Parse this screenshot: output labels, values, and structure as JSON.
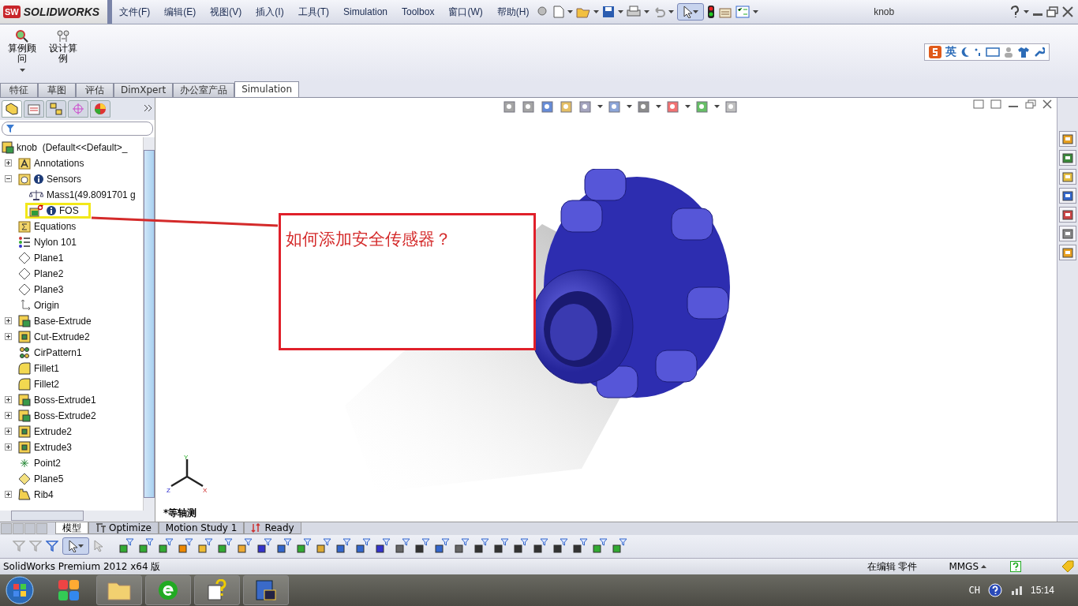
{
  "app": {
    "logo_badge": "SW",
    "logo": "SOLIDWORKS",
    "title": "knob"
  },
  "menu": [
    {
      "label": "文件(F)"
    },
    {
      "label": "编辑(E)"
    },
    {
      "label": "视图(V)"
    },
    {
      "label": "插入(I)"
    },
    {
      "label": "工具(T)"
    },
    {
      "label": "Simulation"
    },
    {
      "label": "Toolbox"
    },
    {
      "label": "窗口(W)"
    },
    {
      "label": "帮助(H)"
    }
  ],
  "commands": [
    {
      "label": "算例顾问",
      "dropdown": true
    },
    {
      "label": "设计算例",
      "dropdown": false
    }
  ],
  "ime": {
    "mode": "英"
  },
  "tabs": [
    {
      "label": "特征",
      "selected": false
    },
    {
      "label": "草图",
      "selected": false
    },
    {
      "label": "评估",
      "selected": false
    },
    {
      "label": "DimXpert",
      "selected": false
    },
    {
      "label": "办公室产品",
      "selected": false
    },
    {
      "label": "Simulation",
      "selected": true
    }
  ],
  "panel_tabs": [
    {
      "kind": "tree",
      "selected": true
    },
    {
      "kind": "property",
      "selected": false
    },
    {
      "kind": "config",
      "selected": false
    },
    {
      "kind": "dim",
      "selected": false
    },
    {
      "kind": "display",
      "selected": false
    }
  ],
  "tree": {
    "root": "knob  (Default<<Default>_",
    "items": [
      {
        "label": "Annotations",
        "kind": "annotations",
        "expanded": false
      },
      {
        "label": "Sensors",
        "kind": "sensors",
        "expanded": true,
        "info": true,
        "children": [
          {
            "label": "Mass1(49.8091701 g",
            "kind": "mass"
          },
          {
            "label": "FOS",
            "kind": "fos",
            "info": true,
            "highlighted": true
          }
        ]
      },
      {
        "label": "Equations",
        "kind": "equations"
      },
      {
        "label": "Nylon 101",
        "kind": "material"
      },
      {
        "label": "Plane1",
        "kind": "plane"
      },
      {
        "label": "Plane2",
        "kind": "plane"
      },
      {
        "label": "Plane3",
        "kind": "plane"
      },
      {
        "label": "Origin",
        "kind": "origin"
      },
      {
        "label": "Base-Extrude",
        "kind": "boss",
        "expanded": false
      },
      {
        "label": "Cut-Extrude2",
        "kind": "cut",
        "expanded": false
      },
      {
        "label": "CirPattern1",
        "kind": "pattern"
      },
      {
        "label": "Fillet1",
        "kind": "fillet"
      },
      {
        "label": "Fillet2",
        "kind": "fillet"
      },
      {
        "label": "Boss-Extrude1",
        "kind": "boss",
        "expanded": false
      },
      {
        "label": "Boss-Extrude2",
        "kind": "boss",
        "expanded": false
      },
      {
        "label": "Extrude2",
        "kind": "cut",
        "expanded": false
      },
      {
        "label": "Extrude3",
        "kind": "cut",
        "expanded": false
      },
      {
        "label": "Point2",
        "kind": "point"
      },
      {
        "label": "Plane5",
        "kind": "plane-selected"
      },
      {
        "label": "Rib4",
        "kind": "rib",
        "expanded": false
      }
    ]
  },
  "viewport": {
    "callout": "如何添加安全传感器？",
    "view_name": "*等轴测",
    "axes": [
      {
        "label": "Y"
      },
      {
        "label": "Z"
      },
      {
        "label": "X"
      }
    ]
  },
  "bottom_tabs": [
    {
      "label": "模型",
      "kind": "plain",
      "selected": true
    },
    {
      "label": "Optimize",
      "kind": "optimize",
      "selected": false
    },
    {
      "label": "Motion Study 1",
      "kind": "plain",
      "selected": false
    },
    {
      "label": "Ready",
      "kind": "ready",
      "selected": false
    }
  ],
  "status": {
    "product": "SolidWorks Premium 2012 x64 版",
    "mode": "在编辑 零件",
    "units": "MMGS"
  },
  "taskbar": {
    "language": "CH",
    "time": "15:14"
  }
}
